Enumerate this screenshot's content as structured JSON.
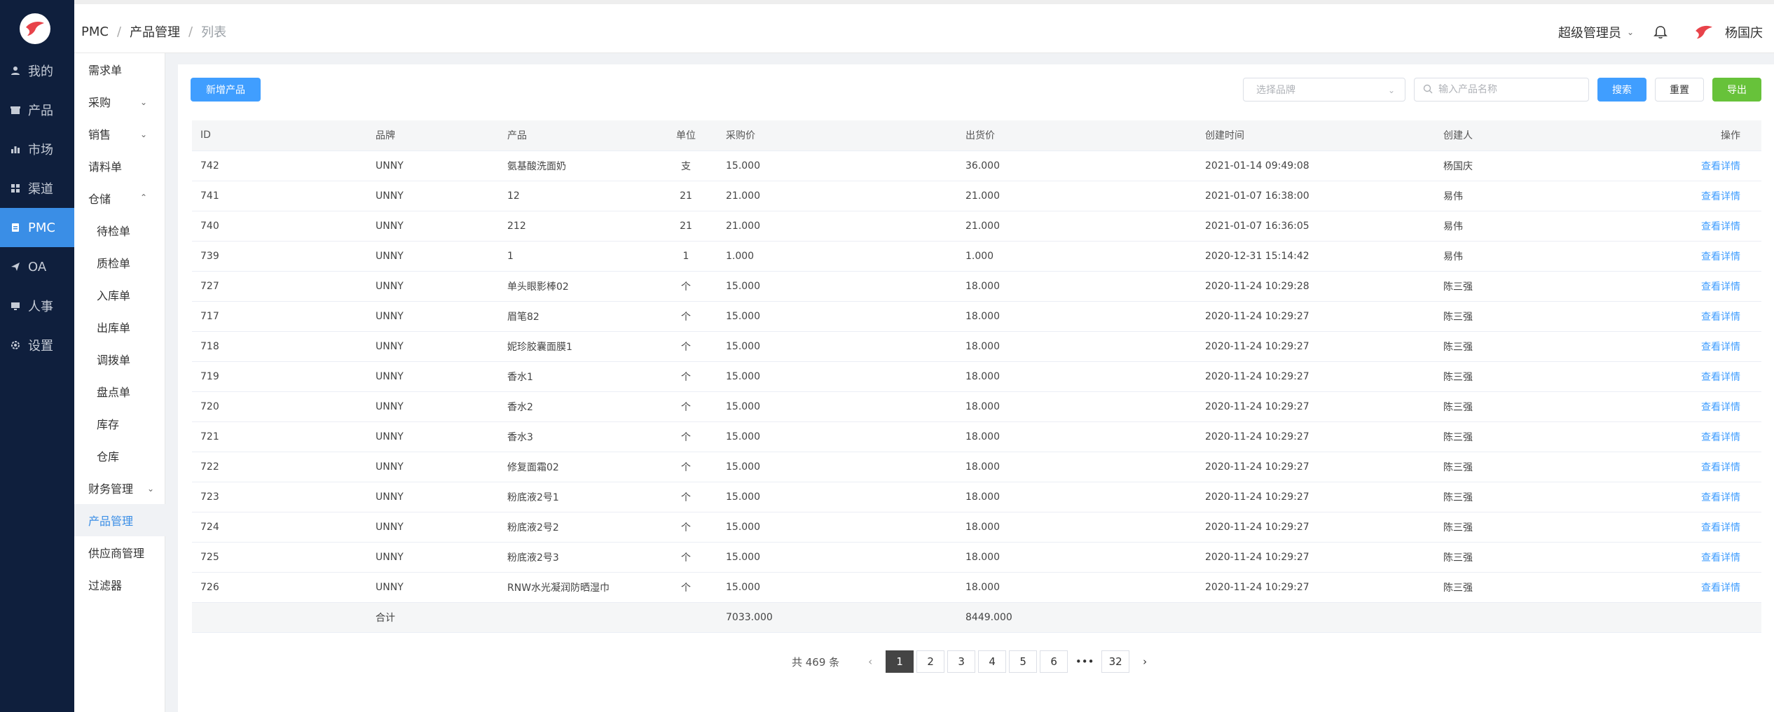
{
  "sidebar": {
    "items": [
      {
        "label": "我的",
        "icon": "user-icon"
      },
      {
        "label": "产品",
        "icon": "shop-icon"
      },
      {
        "label": "市场",
        "icon": "bar-chart-icon"
      },
      {
        "label": "渠道",
        "icon": "grid-icon"
      },
      {
        "label": "PMC",
        "icon": "clipboard-icon"
      },
      {
        "label": "OA",
        "icon": "paper-plane-icon"
      },
      {
        "label": "人事",
        "icon": "monitor-icon"
      },
      {
        "label": "设置",
        "icon": "gear-icon"
      }
    ]
  },
  "submenu": {
    "items": [
      {
        "label": "需求单"
      },
      {
        "label": "采购"
      },
      {
        "label": "销售"
      },
      {
        "label": "请料单"
      },
      {
        "label": "仓储"
      },
      {
        "label": "待检单"
      },
      {
        "label": "质检单"
      },
      {
        "label": "入库单"
      },
      {
        "label": "出库单"
      },
      {
        "label": "调拨单"
      },
      {
        "label": "盘点单"
      },
      {
        "label": "库存"
      },
      {
        "label": "仓库"
      },
      {
        "label": "财务管理"
      },
      {
        "label": "产品管理"
      },
      {
        "label": "供应商管理"
      },
      {
        "label": "过滤器"
      }
    ]
  },
  "header": {
    "breadcrumb": [
      "PMC",
      "产品管理",
      "列表"
    ],
    "role": "超级管理员",
    "user": "杨国庆"
  },
  "toolbar": {
    "add_label": "新增产品",
    "brand_placeholder": "选择品牌",
    "search_placeholder": "输入产品名称",
    "search_label": "搜索",
    "reset_label": "重置",
    "export_label": "导出"
  },
  "table": {
    "columns": [
      "ID",
      "品牌",
      "产品",
      "单位",
      "采购价",
      "出货价",
      "创建时间",
      "创建人",
      "操作"
    ],
    "action_label": "查看详情",
    "rows": [
      [
        "742",
        "UNNY",
        "氨基酸洗面奶",
        "支",
        "15.000",
        "36.000",
        "2021-01-14 09:49:08",
        "杨国庆"
      ],
      [
        "741",
        "UNNY",
        "12",
        "21",
        "21.000",
        "21.000",
        "2021-01-07 16:38:00",
        "易伟"
      ],
      [
        "740",
        "UNNY",
        "212",
        "21",
        "21.000",
        "21.000",
        "2021-01-07 16:36:05",
        "易伟"
      ],
      [
        "739",
        "UNNY",
        "1",
        "1",
        "1.000",
        "1.000",
        "2020-12-31 15:14:42",
        "易伟"
      ],
      [
        "727",
        "UNNY",
        "单头眼影棒02",
        "个",
        "15.000",
        "18.000",
        "2020-11-24 10:29:28",
        "陈三强"
      ],
      [
        "717",
        "UNNY",
        "眉笔82",
        "个",
        "15.000",
        "18.000",
        "2020-11-24 10:29:27",
        "陈三强"
      ],
      [
        "718",
        "UNNY",
        "妮珍胶囊面膜1",
        "个",
        "15.000",
        "18.000",
        "2020-11-24 10:29:27",
        "陈三强"
      ],
      [
        "719",
        "UNNY",
        "香水1",
        "个",
        "15.000",
        "18.000",
        "2020-11-24 10:29:27",
        "陈三强"
      ],
      [
        "720",
        "UNNY",
        "香水2",
        "个",
        "15.000",
        "18.000",
        "2020-11-24 10:29:27",
        "陈三强"
      ],
      [
        "721",
        "UNNY",
        "香水3",
        "个",
        "15.000",
        "18.000",
        "2020-11-24 10:29:27",
        "陈三强"
      ],
      [
        "722",
        "UNNY",
        "修复面霜02",
        "个",
        "15.000",
        "18.000",
        "2020-11-24 10:29:27",
        "陈三强"
      ],
      [
        "723",
        "UNNY",
        "粉底液2号1",
        "个",
        "15.000",
        "18.000",
        "2020-11-24 10:29:27",
        "陈三强"
      ],
      [
        "724",
        "UNNY",
        "粉底液2号2",
        "个",
        "15.000",
        "18.000",
        "2020-11-24 10:29:27",
        "陈三强"
      ],
      [
        "725",
        "UNNY",
        "粉底液2号3",
        "个",
        "15.000",
        "18.000",
        "2020-11-24 10:29:27",
        "陈三强"
      ],
      [
        "726",
        "UNNY",
        "RNW水光凝润防晒湿巾",
        "个",
        "15.000",
        "18.000",
        "2020-11-24 10:29:27",
        "陈三强"
      ]
    ],
    "summary": {
      "label": "合计",
      "purchase_total": "7033.000",
      "sale_total": "8449.000"
    }
  },
  "pagination": {
    "total_text": "共 469 条",
    "pages": [
      "1",
      "2",
      "3",
      "4",
      "5",
      "6"
    ],
    "more": "•••",
    "last": "32",
    "current": "1"
  },
  "colors": {
    "sidebar_bg": "#0f1f3d",
    "accent": "#409eff",
    "success": "#67c23a"
  }
}
